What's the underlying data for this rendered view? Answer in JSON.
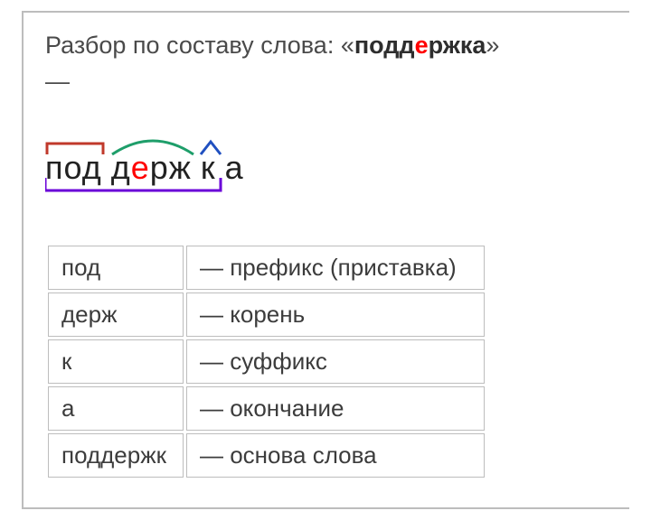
{
  "title": {
    "prefix": "Разбор по составу слова: «",
    "word_before_stress": "подд",
    "word_stress": "е",
    "word_after_stress": "ржка",
    "suffix": "»",
    "dash": "—"
  },
  "diagram": {
    "prefix": "под",
    "root_before_stress": "д",
    "root_stress": "е",
    "root_after_stress": "рж",
    "suffix": "к",
    "ending": "а",
    "colors": {
      "prefix_mark": "#c0392b",
      "root_mark": "#1e9e6a",
      "suffix_mark": "#2050c0",
      "stem_mark": "#6a00d8"
    }
  },
  "table": {
    "rows": [
      {
        "part": "под",
        "desc": "— префикс (приставка)"
      },
      {
        "part": "держ",
        "desc": "— корень"
      },
      {
        "part": "к",
        "desc": "— суффикс"
      },
      {
        "part": "а",
        "desc": "— окончание"
      },
      {
        "part": "поддержк",
        "desc": "— основа слова"
      }
    ]
  }
}
